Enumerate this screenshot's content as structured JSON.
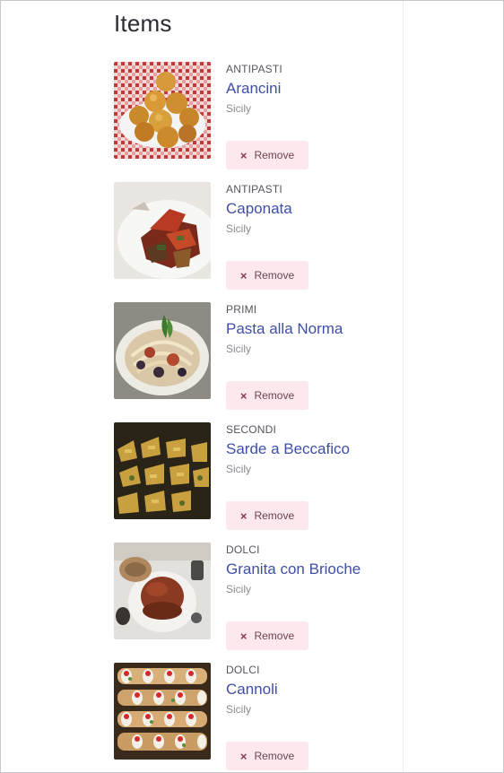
{
  "page": {
    "heading": "Items"
  },
  "items": [
    {
      "category": "ANTIPASTI",
      "name": "Arancini",
      "region": "Sicily",
      "remove_label": "Remove",
      "image_icon": "arancini-photo"
    },
    {
      "category": "ANTIPASTI",
      "name": "Caponata",
      "region": "Sicily",
      "remove_label": "Remove",
      "image_icon": "caponata-photo"
    },
    {
      "category": "PRIMI",
      "name": "Pasta alla Norma",
      "region": "Sicily",
      "remove_label": "Remove",
      "image_icon": "pasta-alla-norma-photo"
    },
    {
      "category": "SECONDI",
      "name": "Sarde a Beccafico",
      "region": "Sicily",
      "remove_label": "Remove",
      "image_icon": "sarde-a-beccafico-photo"
    },
    {
      "category": "DOLCI",
      "name": "Granita con Brioche",
      "region": "Sicily",
      "remove_label": "Remove",
      "image_icon": "granita-con-brioche-photo"
    },
    {
      "category": "DOLCI",
      "name": "Cannoli",
      "region": "Sicily",
      "remove_label": "Remove",
      "image_icon": "cannoli-photo"
    }
  ],
  "colors": {
    "link": "#3f4ea8",
    "remove_bg": "#fde8ee",
    "remove_text": "#6a4450"
  }
}
